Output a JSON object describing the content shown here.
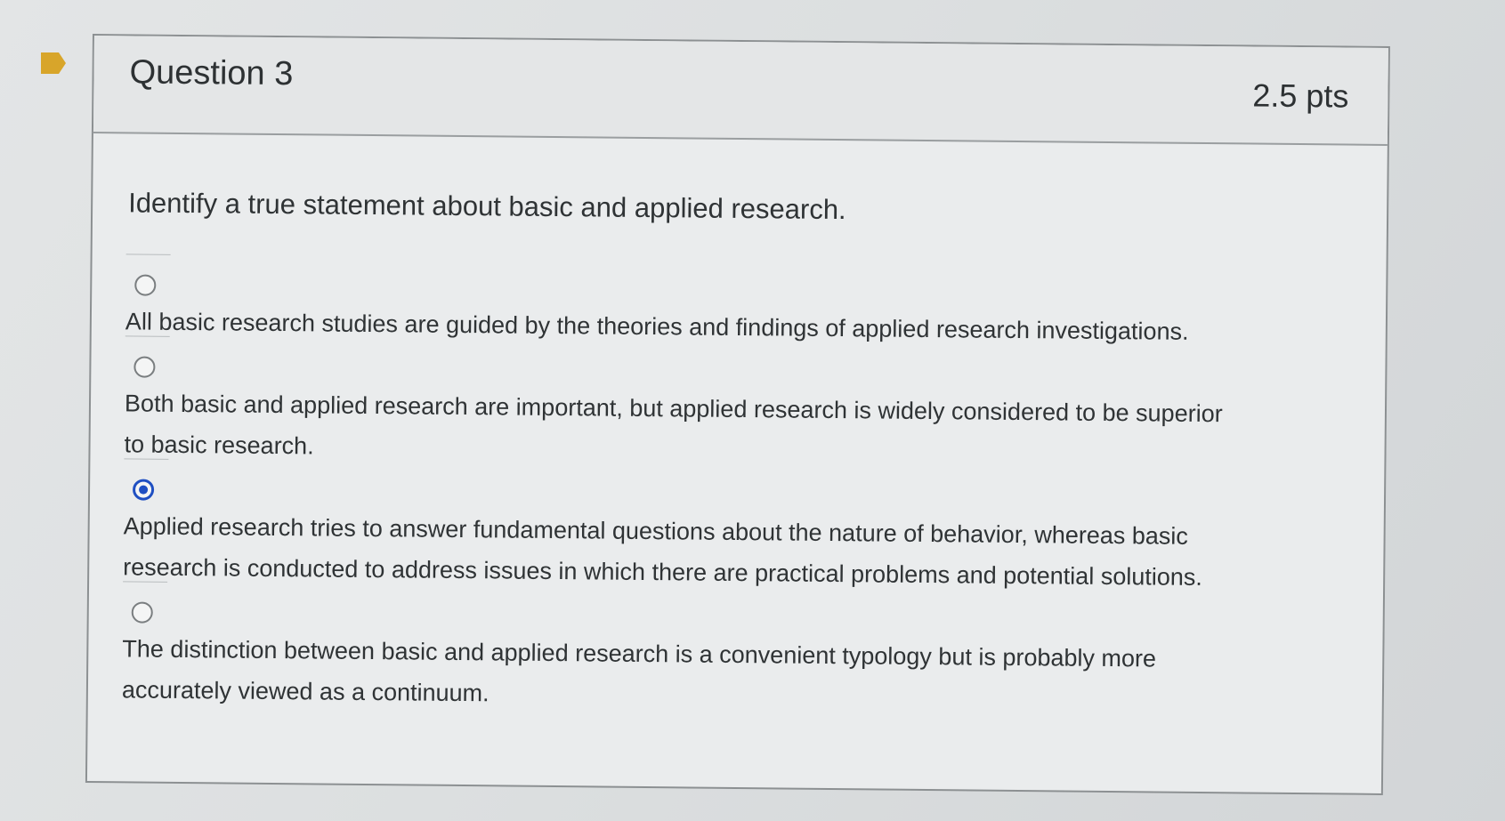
{
  "question": {
    "title": "Question 3",
    "points": "2.5 pts",
    "text": "Identify a true statement about basic and applied research."
  },
  "answers": [
    {
      "label": "All basic research studies are guided by the theories and findings of applied research investigations.",
      "selected": false
    },
    {
      "label": "Both basic and applied research are important, but applied research is widely considered to be superior to basic research.",
      "selected": false
    },
    {
      "label": "Applied research tries to answer fundamental questions about the nature of behavior, whereas basic research is conducted to address issues in which there are practical problems and potential solutions.",
      "selected": true
    },
    {
      "label": "The distinction between basic and applied research is a convenient typology but is probably more accurately viewed as a continuum.",
      "selected": false
    }
  ],
  "colors": {
    "flag": "#d8a52a",
    "selected_radio": "#1f4fc2"
  },
  "icons": {
    "flag": "flag-icon",
    "radio_unchecked": "radio-unchecked-icon",
    "radio_checked": "radio-checked-icon"
  }
}
